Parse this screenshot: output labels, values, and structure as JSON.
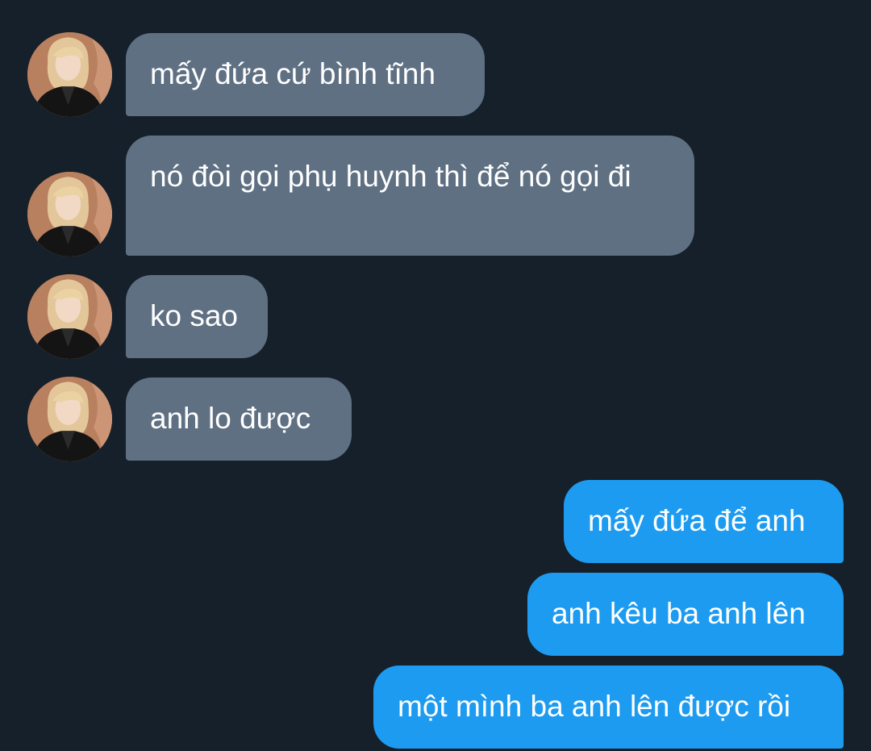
{
  "colors": {
    "background": "#16202a",
    "incoming_bubble": "#5f7083",
    "outgoing_bubble": "#1d9bf0",
    "text": "#ffffff"
  },
  "messages": [
    {
      "direction": "incoming",
      "text": "mấy đứa cứ bình tĩnh",
      "avatar": "sender-photo"
    },
    {
      "direction": "incoming",
      "text": "nó đòi gọi phụ huynh thì để nó gọi đi",
      "avatar": "sender-photo"
    },
    {
      "direction": "incoming",
      "text": "ko sao",
      "avatar": "sender-photo"
    },
    {
      "direction": "incoming",
      "text": "anh lo được",
      "avatar": "sender-photo"
    },
    {
      "direction": "outgoing",
      "text": "mấy đứa để anh"
    },
    {
      "direction": "outgoing",
      "text": "anh kêu ba anh lên"
    },
    {
      "direction": "outgoing",
      "text": "một mình ba anh lên được rồi"
    }
  ]
}
